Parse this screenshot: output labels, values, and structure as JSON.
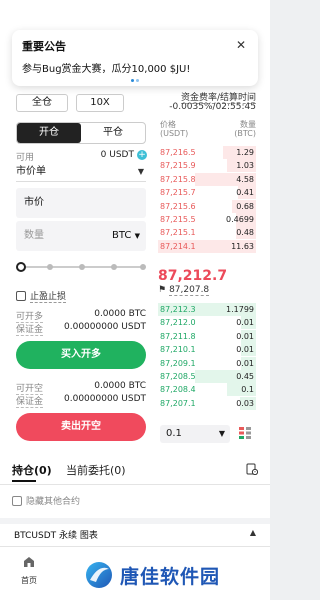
{
  "notice": {
    "title": "重要公告",
    "body": "参与Bug赏金大赛，瓜分10,000 $JU!",
    "close_symbol": "✕"
  },
  "margin_mode": "全仓",
  "leverage": "10X",
  "funding": {
    "label": "资金费率/结算时间",
    "value": "-0.0035%/02:55:45"
  },
  "form": {
    "open_tab": "开仓",
    "close_tab": "平仓",
    "available_label": "可用",
    "available_value": "0 USDT",
    "order_type": "市价单",
    "price_label": "市价",
    "quantity_placeholder": "数量",
    "quantity_unit": "BTC",
    "slider_percent": 0,
    "tpsl_label": "止盈止损",
    "can_open_long_label": "可开多",
    "can_open_long_value": "0.0000 BTC",
    "margin_label": "保证金",
    "margin_long_value": "0.00000000 USDT",
    "buy_button": "买入开多",
    "can_open_short_label": "可开空",
    "can_open_short_value": "0.0000 BTC",
    "margin_short_value": "0.00000000 USDT",
    "sell_button": "卖出开空"
  },
  "orderbook": {
    "price_header": "价格",
    "price_unit": "(USDT)",
    "qty_header": "数量",
    "qty_unit": "(BTC)",
    "asks": [
      {
        "price": "87,216.5",
        "qty": "1.29"
      },
      {
        "price": "87,215.9",
        "qty": "1.03"
      },
      {
        "price": "87,215.8",
        "qty": "4.58"
      },
      {
        "price": "87,215.7",
        "qty": "0.41"
      },
      {
        "price": "87,215.6",
        "qty": "0.68"
      },
      {
        "price": "87,215.5",
        "qty": "0.4699"
      },
      {
        "price": "87,215.1",
        "qty": "0.48"
      },
      {
        "price": "87,214.1",
        "qty": "11.63"
      }
    ],
    "last_price": "87,212.7",
    "mark_price": "87,207.8",
    "bids": [
      {
        "price": "87,212.3",
        "qty": "1.1799"
      },
      {
        "price": "87,212.0",
        "qty": "0.01"
      },
      {
        "price": "87,211.8",
        "qty": "0.01"
      },
      {
        "price": "87,210.1",
        "qty": "0.01"
      },
      {
        "price": "87,209.1",
        "qty": "0.01"
      },
      {
        "price": "87,208.5",
        "qty": "0.45"
      },
      {
        "price": "87,208.4",
        "qty": "0.1"
      },
      {
        "price": "87,207.1",
        "qty": "0.03"
      }
    ],
    "depth_precision": "0.1"
  },
  "positions": {
    "tab_positions": "持仓(0)",
    "tab_orders": "当前委托(0)",
    "hide_other": "隐藏其他合约"
  },
  "chart_bar": {
    "label": "BTCUSDT 永续 图表"
  },
  "nav": {
    "home_label": "首页"
  },
  "watermark": {
    "text": "唐佳软件园"
  },
  "colors": {
    "buy": "#20b25f",
    "sell": "#f04a5d",
    "accent": "#3dbfd6"
  }
}
